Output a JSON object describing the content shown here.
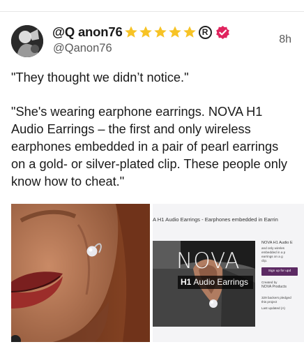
{
  "post": {
    "author": {
      "display_name": "@Q anon76",
      "handle": "@Qanon76",
      "star_count": 5,
      "registered_mark": "R",
      "verified_icon": "verified-badge-icon",
      "accent_color": "#e0245e",
      "star_color": "#f7c325"
    },
    "timestamp": "8h",
    "text": {
      "paragraph_1": "\"They thought we didn’t notice.\"",
      "paragraph_2": "\"She's wearing earphone earrings. NOVA H1 Audio Earrings – the first and only wireless earphones embedded in a pair of pearl earrings on a gold- or silver-plated clip. These people only know how to cheat.\""
    },
    "media": {
      "right_image": {
        "title_bar": "A H1 Audio Earrings - Earphones embedded in Earrin",
        "logo_text": "NOVA",
        "caption_bold": "H1",
        "caption_rest": "Audio Earrings",
        "panel_heading": "NOVA H1 Audio E",
        "panel_lines": [
          "and only wireles",
          "embedded in a p",
          "earrings on a g",
          "clip."
        ],
        "signup_label": "Sign up for upd",
        "created_by_label": "Created by",
        "creator_name": "NOVA Products",
        "footer_lines": [
          "329 backers pledged",
          "this project",
          "Last updated (A)"
        ]
      }
    }
  }
}
